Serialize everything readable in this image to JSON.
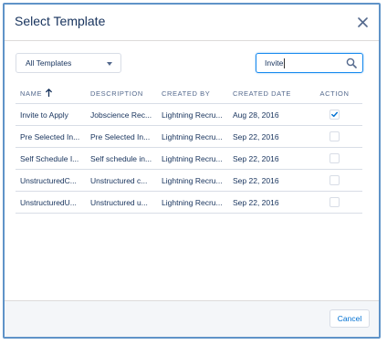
{
  "modal": {
    "title": "Select Template",
    "close_icon": "close-icon"
  },
  "filter": {
    "selected": "All Templates",
    "caret_icon": "caret-down-icon"
  },
  "search": {
    "value": "Invite",
    "icon": "search-icon"
  },
  "table": {
    "columns": [
      "NAME",
      "DESCRIPTION",
      "CREATED BY",
      "CREATED DATE",
      "ACTION"
    ],
    "sort_icon": "arrow-up-icon",
    "rows": [
      {
        "name": "Invite to Apply",
        "description": "Jobscience Rec...",
        "created_by": "Lightning Recru...",
        "created_date": "Aug 28, 2016",
        "selected": true
      },
      {
        "name": "Pre Selected In...",
        "description": "Pre Selected In...",
        "created_by": "Lightning Recru...",
        "created_date": "Sep 22, 2016",
        "selected": false
      },
      {
        "name": "Self Schedule I...",
        "description": "Self schedule in...",
        "created_by": "Lightning Recru...",
        "created_date": "Sep 22, 2016",
        "selected": false
      },
      {
        "name": "UnstructuredC...",
        "description": "Unstructured c...",
        "created_by": "Lightning Recru...",
        "created_date": "Sep 22, 2016",
        "selected": false
      },
      {
        "name": "UnstructuredU...",
        "description": "Unstructured u...",
        "created_by": "Lightning Recru...",
        "created_date": "Sep 22, 2016",
        "selected": false
      }
    ]
  },
  "footer": {
    "cancel_label": "Cancel"
  },
  "colors": {
    "accent": "#0070d2",
    "title": "#16325c",
    "header_text": "#54698d",
    "frame": "#5f93c8",
    "footer_bg": "#f4f6f9"
  }
}
